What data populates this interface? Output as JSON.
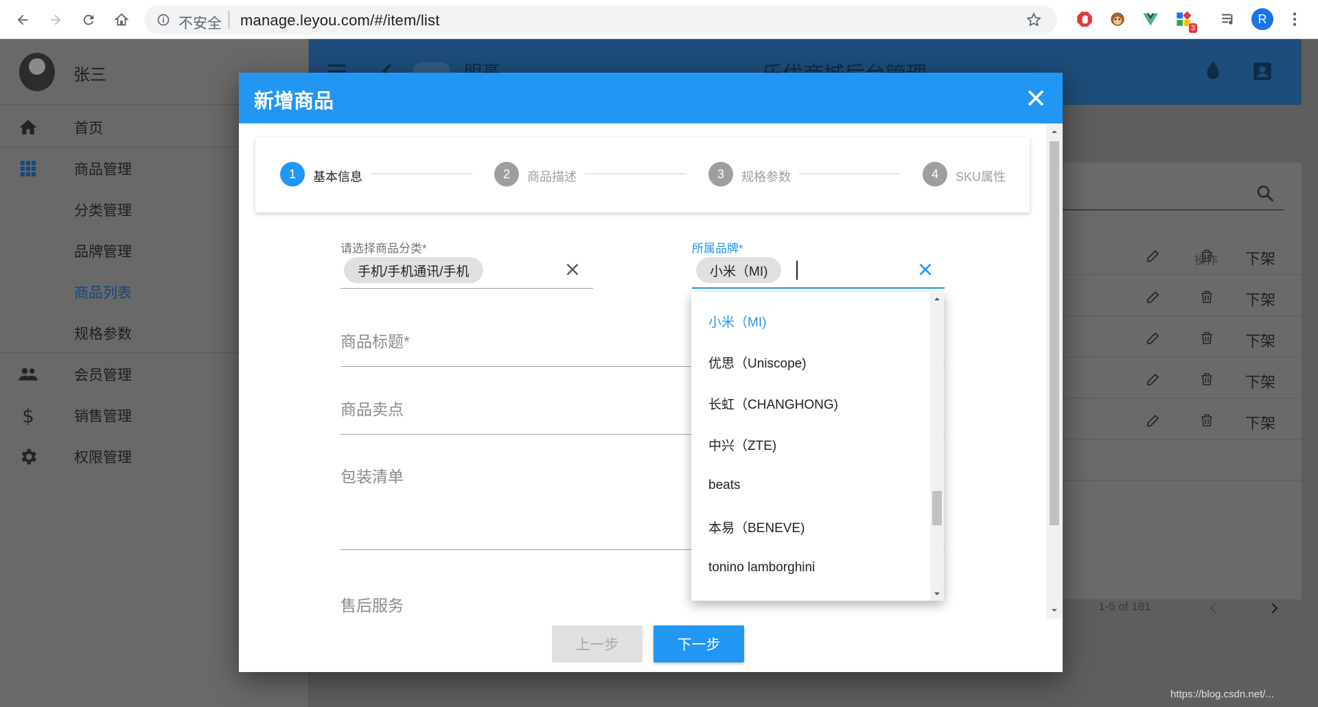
{
  "browser": {
    "insecure_label": "不安全",
    "url": "manage.leyou.com/#/item/list",
    "profile_initial": "R",
    "ext_badge": "3"
  },
  "sidebar": {
    "user_name": "张三",
    "items": [
      {
        "label": "首页",
        "icon": "home-icon"
      },
      {
        "label": "商品管理",
        "icon": "apps-grid-icon"
      },
      {
        "label": "分类管理",
        "icon": ""
      },
      {
        "label": "品牌管理",
        "icon": ""
      },
      {
        "label": "商品列表",
        "icon": "",
        "active": true
      },
      {
        "label": "规格参数",
        "icon": ""
      },
      {
        "label": "会员管理",
        "icon": "people-icon"
      },
      {
        "label": "销售管理",
        "icon": "dollar-icon"
      },
      {
        "label": "权限管理",
        "icon": "gear-icon"
      }
    ]
  },
  "topbar": {
    "theme_label": "明亮",
    "title": "乐优商城后台管理"
  },
  "table": {
    "search_ghost": "索",
    "actions_header": "操作",
    "rows": [
      {
        "ghost": "",
        "off_label": "下架"
      },
      {
        "ghost": ")",
        "off_label": "下架"
      },
      {
        "ghost": "",
        "off_label": "下架"
      },
      {
        "ghost": "",
        "off_label": "下架"
      },
      {
        "ghost": "",
        "off_label": "下架"
      }
    ],
    "pagination": "1-5 of 181"
  },
  "watermark": "https://blog.csdn.net/...",
  "dialog": {
    "title": "新增商品",
    "steps": [
      {
        "num": "1",
        "label": "基本信息",
        "active": true
      },
      {
        "num": "2",
        "label": "商品描述",
        "active": false
      },
      {
        "num": "3",
        "label": "规格参数",
        "active": false
      },
      {
        "num": "4",
        "label": "SKU属性",
        "active": false
      }
    ],
    "category": {
      "label": "请选择商品分类*",
      "value": "手机/手机通讯/手机"
    },
    "brand": {
      "label": "所属品牌*",
      "value": "小米（MI)"
    },
    "fields": {
      "title_placeholder": "商品标题*",
      "subtitle_placeholder": "商品卖点",
      "packing_placeholder": "包装清单",
      "service_placeholder": "售后服务"
    },
    "buttons": {
      "prev": "上一步",
      "next": "下一步"
    }
  },
  "brand_options": [
    {
      "label": "小米（MI)",
      "selected": true
    },
    {
      "label": "优思（Uniscope)",
      "selected": false
    },
    {
      "label": "长虹（CHANGHONG)",
      "selected": false
    },
    {
      "label": "中兴（ZTE)",
      "selected": false
    },
    {
      "label": "beats",
      "selected": false
    },
    {
      "label": "本易（BENEVE)",
      "selected": false
    },
    {
      "label": "tonino lamborghini",
      "selected": false
    }
  ],
  "colors": {
    "primary": "#2196f3",
    "topbar_dimmed": "#1d4d7a",
    "overlay_bg": "#5e5e5e"
  }
}
